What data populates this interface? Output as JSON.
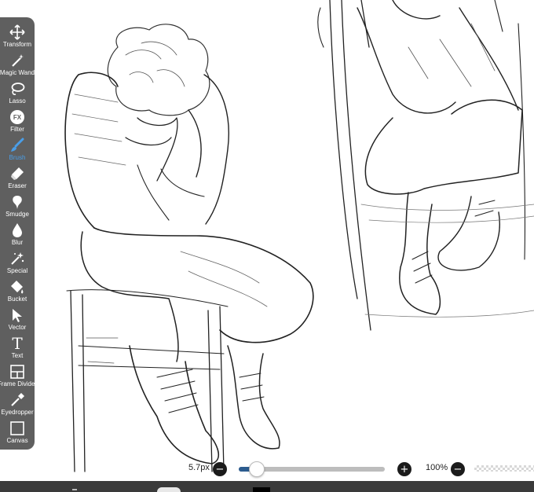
{
  "toolbar": {
    "tools": [
      {
        "label": "Transform",
        "icon": "transform-icon",
        "active": false
      },
      {
        "label": "Magic Wand",
        "icon": "magic-wand-icon",
        "active": false
      },
      {
        "label": "Lasso",
        "icon": "lasso-icon",
        "active": false
      },
      {
        "label": "Filter",
        "icon": "filter-icon",
        "active": false
      },
      {
        "label": "Brush",
        "icon": "brush-icon",
        "active": true
      },
      {
        "label": "Eraser",
        "icon": "eraser-icon",
        "active": false
      },
      {
        "label": "Smudge",
        "icon": "smudge-icon",
        "active": false
      },
      {
        "label": "Blur",
        "icon": "blur-icon",
        "active": false
      },
      {
        "label": "Special",
        "icon": "special-icon",
        "active": false
      },
      {
        "label": "Bucket",
        "icon": "bucket-icon",
        "active": false
      },
      {
        "label": "Vector",
        "icon": "vector-icon",
        "active": false
      },
      {
        "label": "Text",
        "icon": "text-icon",
        "active": false
      },
      {
        "label": "Frame Divider",
        "icon": "frame-divider-icon",
        "active": false
      },
      {
        "label": "Eyedropper",
        "icon": "eyedropper-icon",
        "active": false
      },
      {
        "label": "Canvas",
        "icon": "canvas-icon",
        "active": false
      }
    ],
    "filter_glyph": "FX",
    "text_glyph": "T",
    "active_color": "#4a9ee8",
    "background": "#5f5f5f"
  },
  "brush_controls": {
    "size_label": "5.7px",
    "size_fraction": 0.12,
    "opacity_label": "100%",
    "minus_glyph": "−",
    "plus_glyph": "+",
    "slider_fill_color": "#2c5c8f"
  }
}
